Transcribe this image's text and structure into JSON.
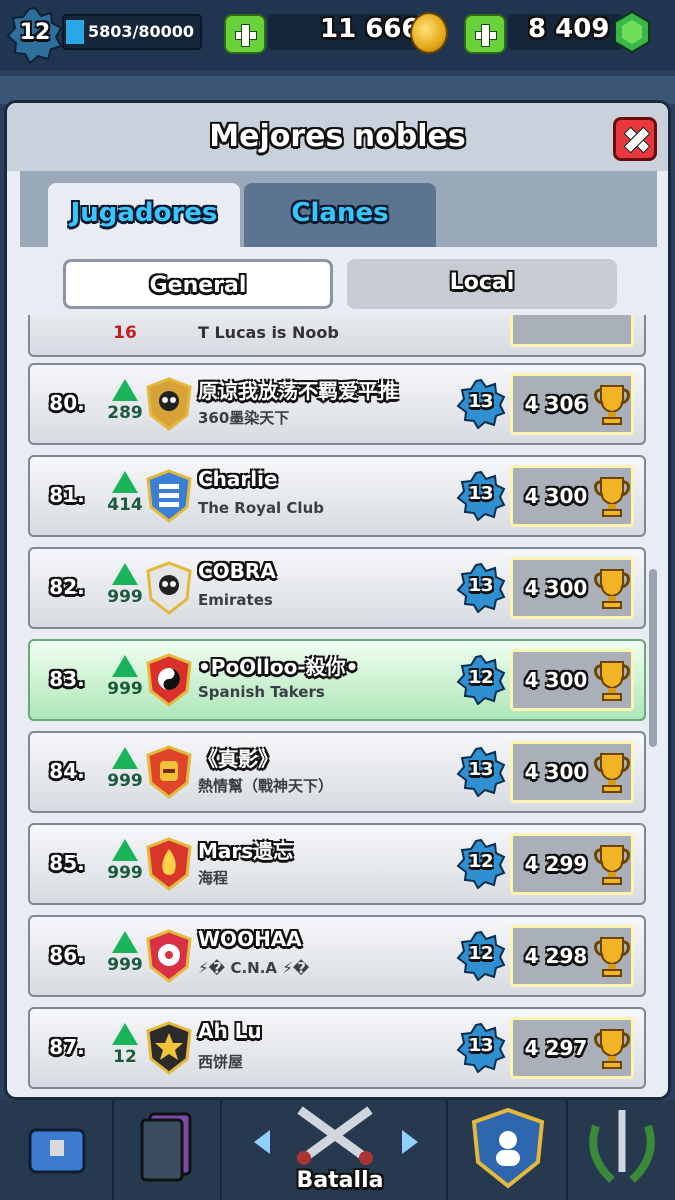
{
  "top": {
    "level": "12",
    "xp": "5803/80000",
    "gold": "11 666",
    "gems": "8 409"
  },
  "modal": {
    "title": "Mejores nobles",
    "tabs": [
      "Jugadores",
      "Clanes"
    ],
    "subtabs": [
      "General",
      "Local"
    ]
  },
  "partial_row": {
    "change": "16",
    "name": "T Lucas is Noob"
  },
  "rows": [
    {
      "rank": "80.",
      "change": "289",
      "name": "原谅我放荡不羁爱平推",
      "clan": "360墨染天下",
      "level": "13",
      "trophies": "4 306",
      "shield": "#d8a23a",
      "emblem": "skull"
    },
    {
      "rank": "81.",
      "change": "414",
      "name": "Charlie",
      "clan": "The Royal Club",
      "level": "13",
      "trophies": "4 300",
      "shield": "#3b7fd6",
      "emblem": "bars"
    },
    {
      "rank": "82.",
      "change": "999",
      "name": "COBRA",
      "clan": "Emirates",
      "level": "13",
      "trophies": "4 300",
      "shield": "#e5e5e5",
      "emblem": "skull"
    },
    {
      "rank": "83.",
      "change": "999",
      "name": "•PoOlloo-殺你•",
      "clan": "Spanish Takers",
      "level": "12",
      "trophies": "4 300",
      "shield": "#d9302c",
      "emblem": "yinyang",
      "me": true
    },
    {
      "rank": "84.",
      "change": "999",
      "name": "《真影》",
      "clan": "熱情幫（戰神天下）",
      "level": "13",
      "trophies": "4 300",
      "shield": "#e0452a",
      "emblem": "helmet"
    },
    {
      "rank": "85.",
      "change": "999",
      "name": "Mars遗忘",
      "clan": "海程",
      "level": "12",
      "trophies": "4 299",
      "shield": "#d9352a",
      "emblem": "fire"
    },
    {
      "rank": "86.",
      "change": "999",
      "name": "WOOHAA",
      "clan": "⚡� C.N.A ⚡�",
      "level": "12",
      "trophies": "4 298",
      "shield": "#d93046",
      "emblem": "flower"
    },
    {
      "rank": "87.",
      "change": "12",
      "name": "Ah Lu",
      "clan": "西饼屋",
      "level": "13",
      "trophies": "4 297",
      "shield": "#2b2b2b",
      "emblem": "star"
    }
  ],
  "bottom": {
    "battle_label": "Batalla"
  },
  "colors": {
    "accent": "#39c6ff",
    "up": "#19b45a",
    "highlight": "#aee6b8"
  },
  "icons": [
    "plus-icon",
    "gold-coin-icon",
    "gem-icon",
    "close-icon",
    "trophy-icon",
    "level-star-icon",
    "rank-up-arrow-icon",
    "clan-shield-icon"
  ]
}
